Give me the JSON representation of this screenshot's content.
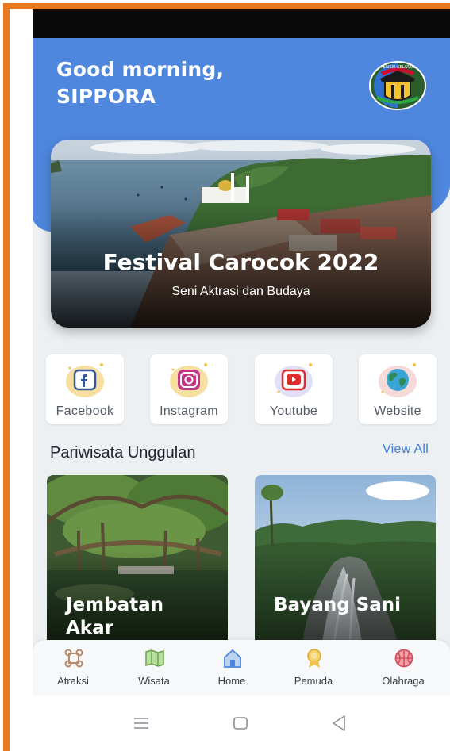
{
  "header": {
    "greeting_line1": "Good morning,",
    "greeting_line2": "SIPPORA",
    "logo_text": "PESISIR SELATAN"
  },
  "hero": {
    "title": "Festival Carocok 2022",
    "subtitle": "Seni Aktrasi dan Budaya"
  },
  "social": [
    {
      "label": "Facebook",
      "icon": "facebook-icon",
      "color": "#3b5998"
    },
    {
      "label": "Instagram",
      "icon": "instagram-icon",
      "color": "#c13584"
    },
    {
      "label": "Youtube",
      "icon": "youtube-icon",
      "color": "#e02b2b"
    },
    {
      "label": "Website",
      "icon": "globe-icon",
      "color": "#2e8b57"
    }
  ],
  "section": {
    "title": "Pariwisata Unggulan",
    "view_all": "View All"
  },
  "cards": [
    {
      "title": "Jembatan\nAkar"
    },
    {
      "title": "Bayang Sani"
    }
  ],
  "nav": [
    {
      "label": "Atraksi",
      "icon": "attraction-icon"
    },
    {
      "label": "Wisata",
      "icon": "map-icon"
    },
    {
      "label": "Home",
      "icon": "home-icon",
      "active": true
    },
    {
      "label": "Pemuda",
      "icon": "medal-icon"
    },
    {
      "label": "Olahraga",
      "icon": "basketball-icon"
    }
  ],
  "colors": {
    "header_blue": "#4f87df",
    "accent_blue": "#3f7fd9",
    "frame_orange": "#e8781e"
  }
}
